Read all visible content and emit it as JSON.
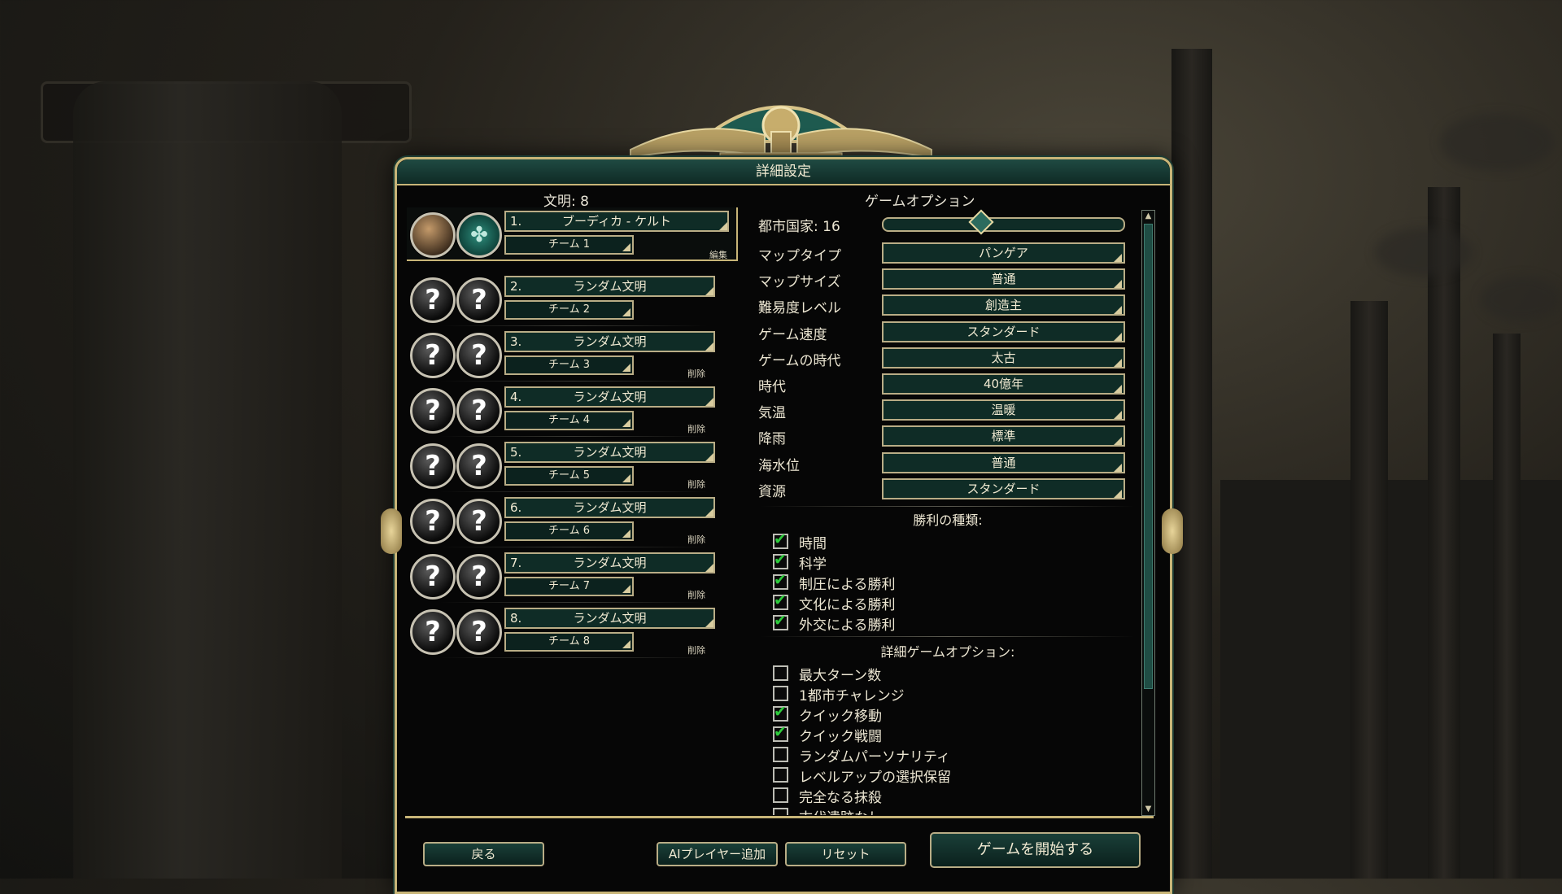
{
  "window": {
    "title": "詳細設定"
  },
  "players": {
    "count_label": "文明: 8",
    "list": [
      {
        "num": "1.",
        "civ": "ブーディカ - ケルト",
        "team": "チーム 1",
        "action": "編集",
        "portrait": "?",
        "civ_icon": "✤"
      },
      {
        "num": "2.",
        "civ": "ランダム文明",
        "team": "チーム 2",
        "action": "",
        "portrait": "?",
        "civ_icon": "?"
      },
      {
        "num": "3.",
        "civ": "ランダム文明",
        "team": "チーム 3",
        "action": "削除",
        "portrait": "?",
        "civ_icon": "?"
      },
      {
        "num": "4.",
        "civ": "ランダム文明",
        "team": "チーム 4",
        "action": "削除",
        "portrait": "?",
        "civ_icon": "?"
      },
      {
        "num": "5.",
        "civ": "ランダム文明",
        "team": "チーム 5",
        "action": "削除",
        "portrait": "?",
        "civ_icon": "?"
      },
      {
        "num": "6.",
        "civ": "ランダム文明",
        "team": "チーム 6",
        "action": "削除",
        "portrait": "?",
        "civ_icon": "?"
      },
      {
        "num": "7.",
        "civ": "ランダム文明",
        "team": "チーム 7",
        "action": "削除",
        "portrait": "?",
        "civ_icon": "?"
      },
      {
        "num": "8.",
        "civ": "ランダム文明",
        "team": "チーム 8",
        "action": "削除",
        "portrait": "?",
        "civ_icon": "?"
      }
    ]
  },
  "options": {
    "title": "ゲームオプション",
    "city_states": {
      "label": "都市国家: 16",
      "value": 16,
      "fraction": 0.39
    },
    "dropdowns": [
      {
        "label": "マップタイプ",
        "value": "パンゲア"
      },
      {
        "label": "マップサイズ",
        "value": "普通"
      },
      {
        "label": "難易度レベル",
        "value": "創造主"
      },
      {
        "label": "ゲーム速度",
        "value": "スタンダード"
      },
      {
        "label": "ゲームの時代",
        "value": "太古"
      },
      {
        "label": "時代",
        "value": "40億年"
      },
      {
        "label": "気温",
        "value": "温暖"
      },
      {
        "label": "降雨",
        "value": "標準"
      },
      {
        "label": "海水位",
        "value": "普通"
      },
      {
        "label": "資源",
        "value": "スタンダード"
      }
    ],
    "victory_title": "勝利の種類:",
    "victory": [
      {
        "label": "時間",
        "checked": true
      },
      {
        "label": "科学",
        "checked": true
      },
      {
        "label": "制圧による勝利",
        "checked": true
      },
      {
        "label": "文化による勝利",
        "checked": true
      },
      {
        "label": "外交による勝利",
        "checked": true
      }
    ],
    "advanced_title": "詳細ゲームオプション:",
    "advanced": [
      {
        "label": "最大ターン数",
        "checked": false
      },
      {
        "label": "1都市チャレンジ",
        "checked": false
      },
      {
        "label": "クイック移動",
        "checked": true
      },
      {
        "label": "クイック戦闘",
        "checked": true
      },
      {
        "label": "ランダムパーソナリティ",
        "checked": false
      },
      {
        "label": "レベルアップの選択保留",
        "checked": false
      },
      {
        "label": "完全なる抹殺",
        "checked": false
      },
      {
        "label": "古代遺跡なし",
        "checked": false
      }
    ]
  },
  "buttons": {
    "back": "戻る",
    "add_ai": "AIプレイヤー追加",
    "reset": "リセット",
    "start": "ゲームを開始する"
  },
  "colors": {
    "accent_gold": "#c8b578",
    "field_teal": "#0f2c26",
    "check_green": "#2ecb3c"
  }
}
